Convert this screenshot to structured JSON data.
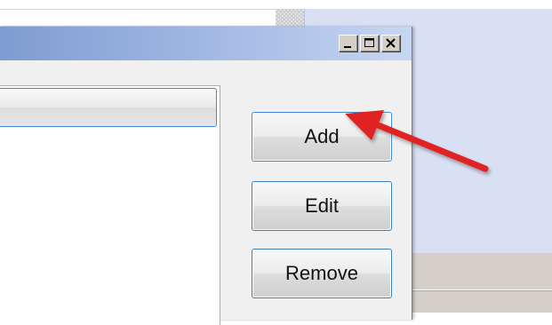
{
  "dialog": {
    "title_controls": [
      "minimize-icon",
      "maximize-icon",
      "close-icon"
    ]
  },
  "buttons": {
    "add_label": "Add",
    "edit_label": "Edit",
    "remove_label": "Remove"
  },
  "annotation": {
    "arrow_color": "#e02020",
    "arrow_target": "add-button"
  },
  "colors": {
    "titlebar_start": "#7f9cd0",
    "titlebar_end": "#c7d6f1",
    "button_border": "#3c7fb1",
    "panel_background": "#d9e0f3"
  }
}
